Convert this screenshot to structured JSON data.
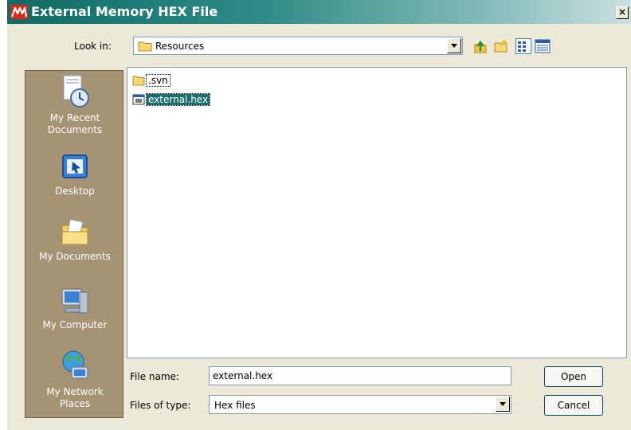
{
  "window": {
    "title": "External Memory HEX File",
    "close_glyph": "×",
    "app_icon": "microchip-logo-icon"
  },
  "lookin": {
    "label": "Look in:",
    "value": "Resources"
  },
  "toolbar": {
    "icons": [
      "up-folder-icon",
      "new-folder-icon",
      "list-view-icon",
      "details-view-icon"
    ]
  },
  "places": {
    "items": [
      {
        "label_line1": "My Recent",
        "label_line2": "Documents",
        "icon": "recent-documents-icon"
      },
      {
        "label_line1": "Desktop",
        "label_line2": "",
        "icon": "desktop-icon"
      },
      {
        "label_line1": "My Documents",
        "label_line2": "",
        "icon": "my-documents-icon"
      },
      {
        "label_line1": "My Computer",
        "label_line2": "",
        "icon": "my-computer-icon"
      },
      {
        "label_line1": "My Network",
        "label_line2": "Places",
        "icon": "network-places-icon"
      }
    ]
  },
  "files": {
    "items": [
      {
        "name": ".svn",
        "type": "folder",
        "selected": false
      },
      {
        "name": "external.hex",
        "type": "hex-file",
        "selected": true
      }
    ]
  },
  "filename": {
    "label": "File name:",
    "value": "external.hex"
  },
  "filetype": {
    "label": "Files of type:",
    "value": "Hex files"
  },
  "buttons": {
    "open": "Open",
    "cancel": "Cancel"
  },
  "colors": {
    "titlebar": "#0f6b64",
    "places_bg": "#a59374",
    "selection": "#1d6e6e",
    "dialog_bg": "#ece9d8"
  }
}
